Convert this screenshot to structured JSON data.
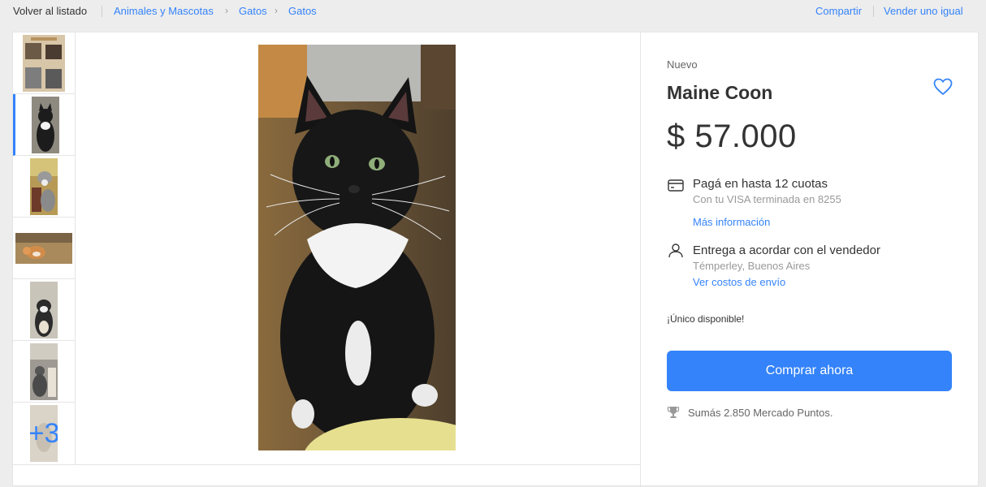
{
  "nav": {
    "back_label": "Volver al listado",
    "breadcrumbs": [
      "Animales y Mascotas",
      "Gatos",
      "Gatos"
    ],
    "share_label": "Compartir",
    "sell_label": "Vender uno igual"
  },
  "gallery": {
    "more_count": "+3"
  },
  "product": {
    "condition": "Nuevo",
    "title": "Maine Coon",
    "price": "$ 57.000"
  },
  "payment": {
    "title": "Pagá en hasta 12 cuotas",
    "subtitle": "Con tu VISA terminada en 8255",
    "link": "Más información"
  },
  "delivery": {
    "title": "Entrega a acordar con el vendedor",
    "location": "Témperley, Buenos Aires",
    "link": "Ver costos de envío"
  },
  "stock_text": "¡Único disponible!",
  "buy_button": "Comprar ahora",
  "points_text": "Sumás 2.850 Mercado Puntos.",
  "colors": {
    "accent": "#3483fa"
  }
}
